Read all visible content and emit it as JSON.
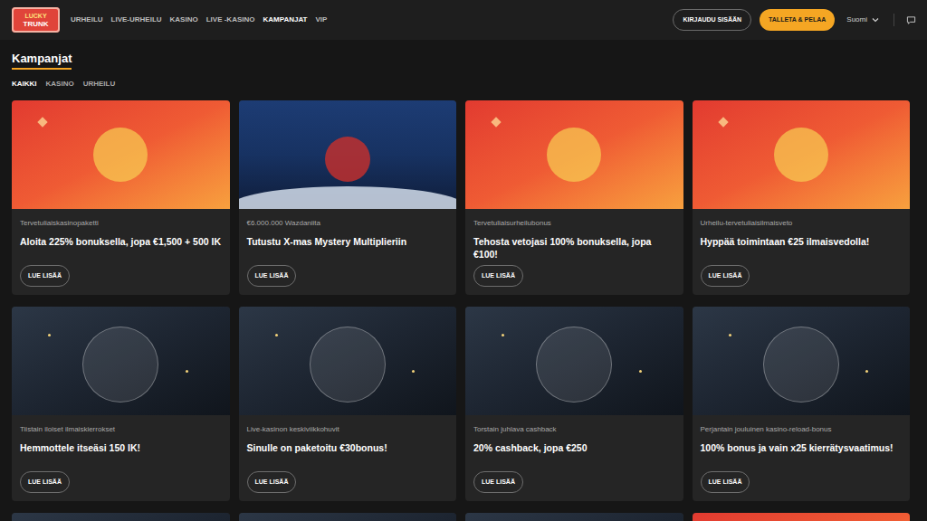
{
  "logo": {
    "line1": "LUCKY",
    "line2": "TRUNK"
  },
  "nav": [
    {
      "label": "URHEILU",
      "selected": false
    },
    {
      "label": "LIVE-URHEILU",
      "selected": false
    },
    {
      "label": "KASINO",
      "selected": false
    },
    {
      "label": "LIVE -KASINO",
      "selected": false
    },
    {
      "label": "KAMPANJAT",
      "selected": true
    },
    {
      "label": "VIP",
      "selected": false
    }
  ],
  "login_button": "KIRJAUDU SISÄÄN",
  "deposit_button": "TALLETA & PELAA",
  "language": "Suomi",
  "page_title": "Kampanjat",
  "filters": [
    {
      "label": "KAIKKI",
      "selected": true
    },
    {
      "label": "KASINO",
      "selected": false
    },
    {
      "label": "URHEILU",
      "selected": false
    }
  ],
  "cards": [
    {
      "kind": "warm",
      "category": "Tervetuliaiskasinopaketti",
      "title": "Aloita 225% bonuksella, jopa €1,500 + 500 IK",
      "button": "LUE LISÄÄ"
    },
    {
      "kind": "blue",
      "category": "€6.000.000 Wazdaniita",
      "title": "Tutustu X-mas Mystery Multiplieriin",
      "button": "LUE LISÄÄ"
    },
    {
      "kind": "warm",
      "category": "Tervetuliaisurheilubonus",
      "title": "Tehosta vetojasi 100% bonuksella, jopa €100!",
      "button": "LUE LISÄÄ"
    },
    {
      "kind": "warm",
      "category": "Urheilu-tervetuliaisilmaisveto",
      "title": "Hyppää toimintaan €25 ilmaisvedolla!",
      "button": "LUE LISÄÄ"
    },
    {
      "kind": "night",
      "category": "Tiistain iloiset ilmaiskierrokset",
      "title": "Hemmottele itseäsi 150 IK!",
      "button": "LUE LISÄÄ"
    },
    {
      "kind": "night",
      "category": "Live-kasinon keskiviikkohuvit",
      "title": "Sinulle on paketoitu €30bonus!",
      "button": "LUE LISÄÄ"
    },
    {
      "kind": "night",
      "category": "Torstain juhlava cashback",
      "title": "20% cashback, jopa €250",
      "button": "LUE LISÄÄ"
    },
    {
      "kind": "night",
      "category": "Perjantain jouluinen kasino-reload-bonus",
      "title": "100% bonus ja vain x25 kierrätysvaatimus!",
      "button": "LUE LISÄÄ"
    }
  ],
  "more_cards": [
    {
      "kind": "night"
    },
    {
      "kind": "night"
    },
    {
      "kind": "night"
    },
    {
      "kind": "warm"
    }
  ]
}
